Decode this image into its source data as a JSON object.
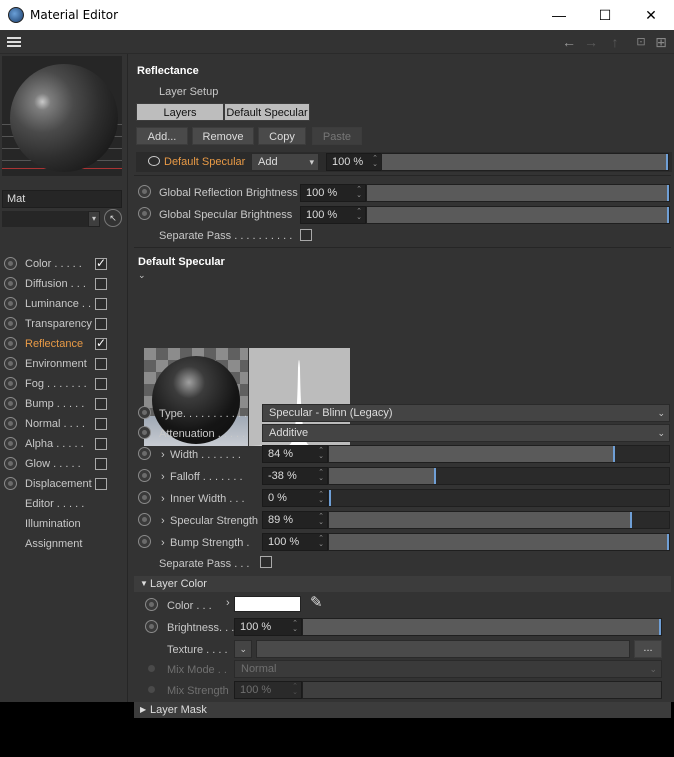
{
  "window": {
    "title": "Material Editor",
    "minimize": "—",
    "maximize": "☐",
    "close": "✕"
  },
  "toolbar": {
    "back": "←",
    "forward": "→",
    "up": "↑",
    "lock": "🔒",
    "new": "⊞"
  },
  "left": {
    "material_name": "Mat",
    "channels": [
      {
        "label": "Color . . . . .",
        "checked": true,
        "active": false
      },
      {
        "label": "Diffusion . . .",
        "checked": false,
        "active": false
      },
      {
        "label": "Luminance . .",
        "checked": false,
        "active": false
      },
      {
        "label": "Transparency",
        "checked": false,
        "active": false
      },
      {
        "label": "Reflectance",
        "checked": true,
        "active": true
      },
      {
        "label": "Environment",
        "checked": false,
        "active": false
      },
      {
        "label": "Fog . . . . . . .",
        "checked": false,
        "active": false
      },
      {
        "label": "Bump . . . . .",
        "checked": false,
        "active": false
      },
      {
        "label": "Normal . . . .",
        "checked": false,
        "active": false
      },
      {
        "label": "Alpha . . . . .",
        "checked": false,
        "active": false
      },
      {
        "label": "Glow . . . . .",
        "checked": false,
        "active": false
      },
      {
        "label": "Displacement",
        "checked": false,
        "active": false
      }
    ],
    "extras": [
      "Editor . . . . .",
      "Illumination",
      "Assignment"
    ]
  },
  "reflectance": {
    "heading": "Reflectance",
    "layer_setup": "Layer Setup",
    "tab_layers": "Layers",
    "tab_default_specular": "Default Specular",
    "btn_add": "Add...",
    "btn_remove": "Remove",
    "btn_copy": "Copy",
    "btn_paste": "Paste",
    "layer_row": {
      "name": "Default Specular",
      "blend": "Add",
      "amount": "100 %",
      "amount_fraction": 1.0
    },
    "global_reflection": {
      "label": "Global Reflection Brightness",
      "value": "100 %",
      "fraction": 1.0
    },
    "global_specular": {
      "label": "Global Specular Brightness",
      "value": "100 %",
      "fraction": 1.0
    },
    "separate_pass": "Separate Pass . . . . . . . . . ."
  },
  "default_specular": {
    "heading": "Default Specular",
    "type_label": "Type. . . . . . . . . . .",
    "type_value": "Specular - Blinn (Legacy)",
    "attenuation_label": "Attenuation . . . . .",
    "attenuation_value": "Additive",
    "width": {
      "label": "Width . . . . . . .",
      "value": "84 %",
      "fraction": 0.84
    },
    "falloff": {
      "label": "Falloff . . . . . . .",
      "value": "-38 %",
      "fraction": 0.31
    },
    "inner_width": {
      "label": "Inner Width . . .",
      "value": "0 %",
      "fraction": 0.0
    },
    "specular_strength": {
      "label": "Specular Strength",
      "value": "89 %",
      "fraction": 0.89
    },
    "bump_strength": {
      "label": "Bump Strength .",
      "value": "100 %",
      "fraction": 1.0
    },
    "separate_pass": "Separate Pass . . ."
  },
  "layer_color": {
    "heading": "Layer Color",
    "color_label": "Color . . .",
    "color_swatch": "#ffffff",
    "brightness_label": "Brightness. . .",
    "brightness_value": "100 %",
    "brightness_fraction": 1.0,
    "texture_label": "Texture . . . .",
    "texture_more": "...",
    "mix_mode_label": "Mix Mode . .",
    "mix_mode_value": "Normal",
    "mix_strength_label": "Mix Strength",
    "mix_strength_value": "100 %"
  },
  "layer_mask": {
    "heading": "Layer Mask"
  },
  "colors": {
    "accent": "#e89a46",
    "knob": "#6f9fd6",
    "panel": "#333333"
  }
}
